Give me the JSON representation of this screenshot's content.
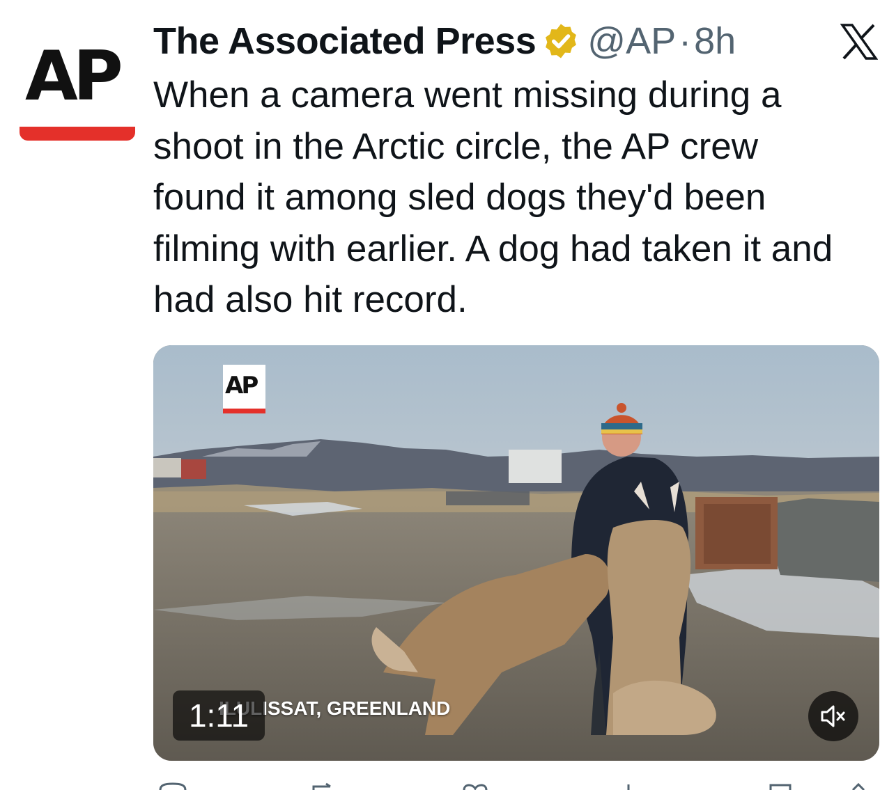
{
  "tweet": {
    "author_name": "The Associated Press",
    "handle": "@AP",
    "separator": "·",
    "time": "8h",
    "avatar_text": "AP",
    "text": "When a camera went missing during a shoot in the Arctic circle, the AP crew found it among sled dogs they'd been filming with earlier. A dog had taken it and had also hit record."
  },
  "media": {
    "watermark": "AP",
    "duration": "1:11",
    "caption": "ILULISSAT, GREENLAND"
  },
  "icons": {
    "verified": "verified-badge-icon",
    "platform": "x-logo-icon",
    "mute": "speaker-muted-icon",
    "reply": "reply-icon",
    "repost": "repost-icon",
    "like": "like-icon",
    "views": "views-icon",
    "bookmark": "bookmark-icon",
    "share": "share-icon"
  },
  "colors": {
    "brand_red": "#e4302a",
    "verified_gold": "#e2b719",
    "secondary_text": "#536471"
  }
}
